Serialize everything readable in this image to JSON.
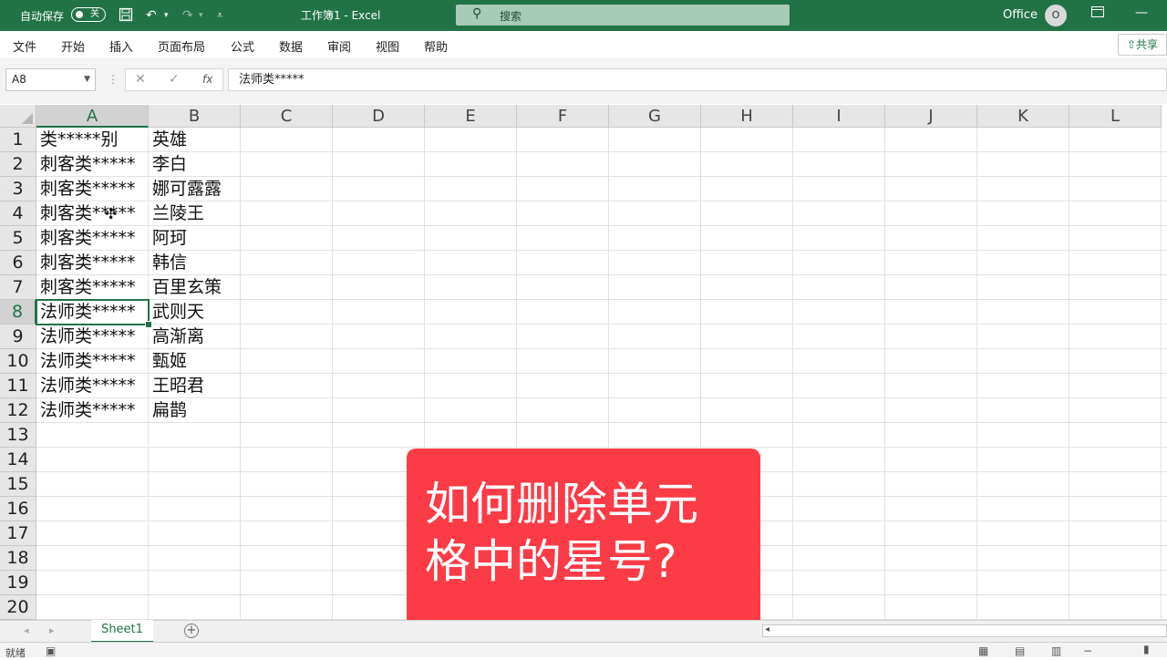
{
  "titlebar": {
    "autosave_label": "自动保存",
    "autosave_state": "关",
    "doc_title": "工作簿1  -  Excel",
    "search_placeholder": "搜索",
    "account_label": "Office",
    "avatar_initial": "O"
  },
  "ribbon": {
    "tabs": [
      "文件",
      "开始",
      "插入",
      "页面布局",
      "公式",
      "数据",
      "审阅",
      "视图",
      "帮助"
    ],
    "share_label": "共享"
  },
  "formula_bar": {
    "name_box": "A8",
    "formula": "法师类*****",
    "fx_label": "fx"
  },
  "grid": {
    "columns": [
      "A",
      "B",
      "C",
      "D",
      "E",
      "F",
      "G",
      "H",
      "I",
      "J",
      "K",
      "L"
    ],
    "rows": [
      "1",
      "2",
      "3",
      "4",
      "5",
      "6",
      "7",
      "8",
      "9",
      "10",
      "11",
      "12",
      "13",
      "14",
      "15",
      "16",
      "17",
      "18",
      "19",
      "20"
    ],
    "selected_column": "A",
    "selected_row": "8",
    "data": [
      [
        "类*****别",
        "英雄"
      ],
      [
        "刺客类*****",
        "李白"
      ],
      [
        "刺客类*****",
        "娜可露露"
      ],
      [
        "刺客类*****",
        "兰陵王"
      ],
      [
        "刺客类*****",
        "阿珂"
      ],
      [
        "刺客类*****",
        "韩信"
      ],
      [
        "刺客类*****",
        "百里玄策"
      ],
      [
        "法师类*****",
        "武则天"
      ],
      [
        "法师类*****",
        "高渐离"
      ],
      [
        "法师类*****",
        "甄姬"
      ],
      [
        "法师类*****",
        "王昭君"
      ],
      [
        "法师类*****",
        "扁鹊"
      ]
    ]
  },
  "overlay": {
    "line1": "如何删除单元",
    "line2": "格中的星号?"
  },
  "sheets": {
    "tabs": [
      "Sheet1"
    ]
  },
  "status": {
    "ready": "就绪"
  },
  "colors": {
    "excel_green": "#217346",
    "overlay_red": "#fb3b45"
  }
}
